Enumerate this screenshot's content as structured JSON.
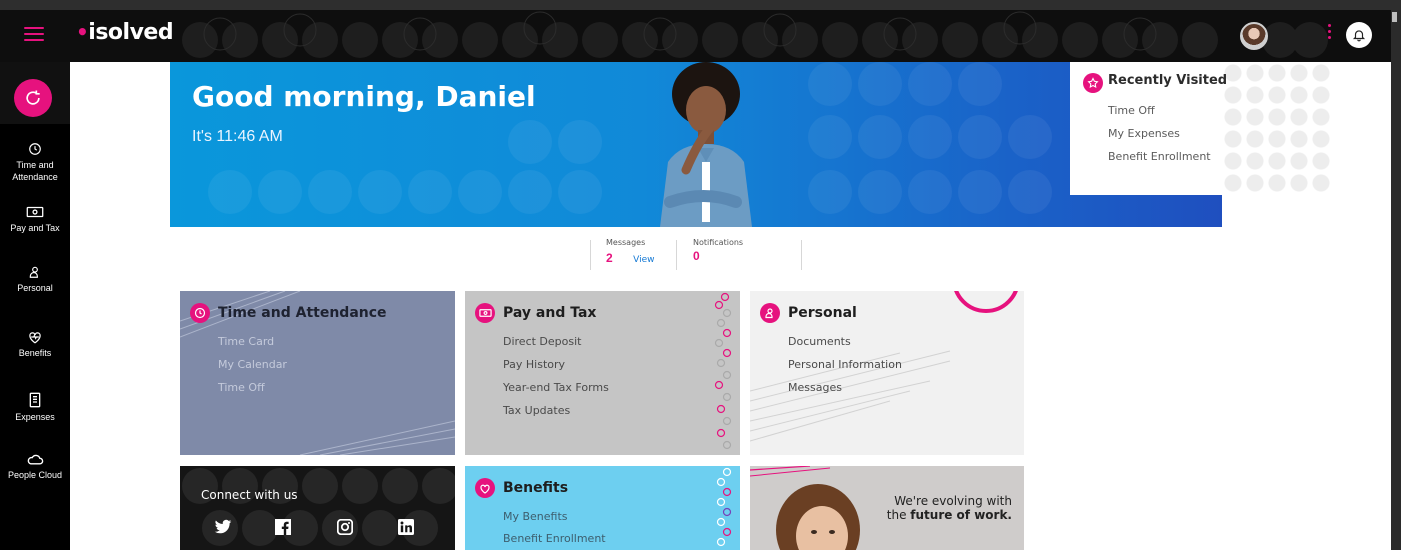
{
  "brand": {
    "logo": "isolved",
    "accent": "#e6127e"
  },
  "sidebar": {
    "items": [
      {
        "label": "Time and Attendance",
        "line1": "Time and",
        "line2": "Attendance",
        "icon": "clock-icon"
      },
      {
        "label": "Pay and Tax",
        "icon": "money-icon"
      },
      {
        "label": "Personal",
        "icon": "person-icon"
      },
      {
        "label": "Benefits",
        "icon": "heart-icon"
      },
      {
        "label": "Expenses",
        "icon": "receipt-icon"
      },
      {
        "label": "People Cloud",
        "icon": "cloud-icon"
      }
    ]
  },
  "hero": {
    "greeting": "Good morning, Daniel",
    "time": "It's 11:46 AM"
  },
  "recent": {
    "title": "Recently Visited",
    "links": [
      "Time Off",
      "My Expenses",
      "Benefit Enrollment"
    ]
  },
  "stats": {
    "messages_label": "Messages",
    "messages_count": "2",
    "view_label": "View",
    "notifications_label": "Notifications",
    "notifications_count": "0"
  },
  "cards": {
    "time": {
      "title": "Time and Attendance",
      "links": [
        "Time Card",
        "My Calendar",
        "Time Off"
      ]
    },
    "pay": {
      "title": "Pay and Tax",
      "links": [
        "Direct Deposit",
        "Pay History",
        "Year-end Tax Forms",
        "Tax Updates"
      ]
    },
    "personal": {
      "title": "Personal",
      "links": [
        "Documents",
        "Personal Information",
        "Messages"
      ]
    },
    "connect": {
      "title": "Connect with us"
    },
    "benefits": {
      "title": "Benefits",
      "links": [
        "My Benefits",
        "Benefit Enrollment"
      ]
    },
    "promo": {
      "line1": "We're evolving with",
      "line2_prefix": "the ",
      "line2_bold": "future of work."
    }
  }
}
